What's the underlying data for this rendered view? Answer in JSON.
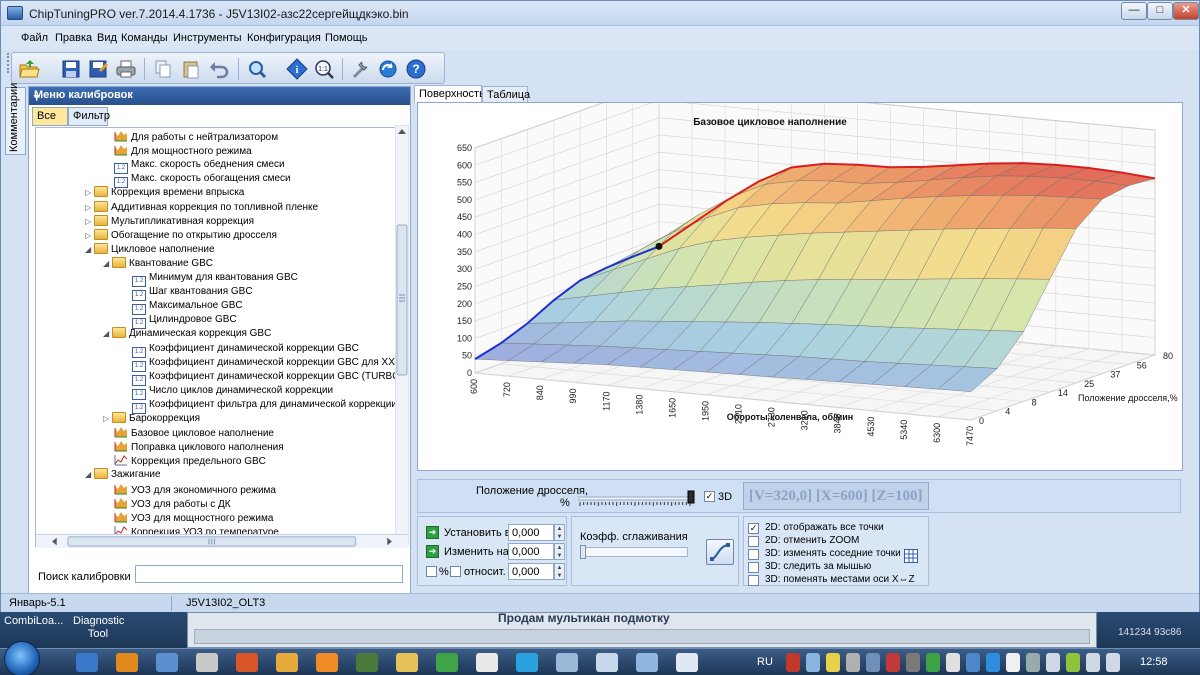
{
  "window": {
    "title": "ChipTuningPRO ver.7.2014.4.1736 - J5V13I02-азс22сергейщдкэко.bin",
    "min_label": "—",
    "max_label": "□",
    "close_label": "✕"
  },
  "menu": [
    "Файл",
    "Правка",
    "Вид",
    "Команды",
    "Инструменты",
    "Конфигурация",
    "Помощь"
  ],
  "toolbar_icons": [
    "open-folder-icon",
    "save-icon",
    "save-as-icon",
    "print-icon",
    "copy-icon",
    "paste-icon",
    "undo-icon",
    "find-icon",
    "info-icon",
    "zoom-icon",
    "tools-icon",
    "refresh-icon",
    "help-icon"
  ],
  "side_tab": "Комментарии",
  "calibration_panel": {
    "title": "Меню калибровок",
    "pin": "ᚁ",
    "tab_all": "Все",
    "tab_filter": "Фильтр",
    "search_label": "Поиск калибровки",
    "search_value": ""
  },
  "tree": [
    {
      "label": "Для работы с нейтрализатором",
      "icon": "chart",
      "level": 3
    },
    {
      "label": "Для мощностного режима",
      "icon": "chart",
      "level": 3
    },
    {
      "label": "Макс. скорость обеднения смеси",
      "icon": "table",
      "level": 3
    },
    {
      "label": "Макс. скорость обогащения смеси",
      "icon": "table",
      "level": 3
    },
    {
      "label": "Коррекция времени впрыска",
      "icon": "folder",
      "level": 2,
      "arrow": "▷"
    },
    {
      "label": "Аддитивная коррекция по топливной пленке",
      "icon": "folder",
      "level": 2,
      "arrow": "▷"
    },
    {
      "label": "Мультипликативная коррекция",
      "icon": "folder",
      "level": 2,
      "arrow": "▷"
    },
    {
      "label": "Обогащение по открытию дросселя",
      "icon": "folder",
      "level": 2,
      "arrow": "▷"
    },
    {
      "label": "Цикловое наполнение",
      "icon": "folder",
      "level": 2,
      "arrow": "◢"
    },
    {
      "label": "Квантование GBC",
      "icon": "folder",
      "level": 3,
      "arrow": "◢"
    },
    {
      "label": "Минимум для квантования GBC",
      "icon": "table",
      "level": 4
    },
    {
      "label": "Шаг квантования GBC",
      "icon": "table",
      "level": 4
    },
    {
      "label": "Максимальное GBC",
      "icon": "table",
      "level": 4
    },
    {
      "label": "Цилиндровое GBC",
      "icon": "table",
      "level": 4
    },
    {
      "label": "Динамическая коррекция GBC",
      "icon": "folder",
      "level": 3,
      "arrow": "◢"
    },
    {
      "label": "Коэффициент динамической коррекции GBC",
      "icon": "table",
      "level": 4
    },
    {
      "label": "Коэффициент динамической коррекции GBC для XX",
      "icon": "table",
      "level": 4
    },
    {
      "label": "Коэффициент динамической коррекции GBC (TURBO)",
      "icon": "table",
      "level": 4
    },
    {
      "label": "Число циклов динамической коррекции",
      "icon": "table",
      "level": 4
    },
    {
      "label": "Коэффициент фильтра для динамической коррекции",
      "icon": "table",
      "level": 4
    },
    {
      "label": "Барокоррекция",
      "icon": "folder",
      "level": 3,
      "arrow": "▷"
    },
    {
      "label": "Базовое цикловое наполнение",
      "icon": "chart",
      "level": 3
    },
    {
      "label": "Поправка циклового наполнения",
      "icon": "chart",
      "level": 3
    },
    {
      "label": "Коррекция предельного GBC",
      "icon": "line",
      "level": 3
    },
    {
      "label": "Зажигание",
      "icon": "folder",
      "level": 2,
      "arrow": "◢"
    },
    {
      "label": "УОЗ для экономичного режима",
      "icon": "chart",
      "level": 3
    },
    {
      "label": "УОЗ для работы с ДК",
      "icon": "chart",
      "level": 3
    },
    {
      "label": "УОЗ для мощностного режима",
      "icon": "chart",
      "level": 3
    },
    {
      "label": "Коррекция УОЗ по температуре",
      "icon": "line",
      "level": 3
    }
  ],
  "status": {
    "left": "Январь-5.1",
    "right": "J5V13I02_OLT3"
  },
  "view_tabs": [
    "Поверхность",
    "Таблица"
  ],
  "chart_data": {
    "type": "surface",
    "title": "Базовое цикловое наполнение",
    "xlabel": "Обороты коленвала, об/мин",
    "ylabel": "Положение дросселя,%",
    "x_ticks": [
      "600",
      "720",
      "840",
      "990",
      "1170",
      "1380",
      "1650",
      "1950",
      "2310",
      "2730",
      "3210",
      "3840",
      "4530",
      "5340",
      "6300",
      "7470"
    ],
    "y_ticks": [
      "0",
      "4",
      "8",
      "14",
      "25",
      "37",
      "56",
      "80"
    ],
    "z_ticks": [
      "0",
      "50",
      "100",
      "150",
      "200",
      "250",
      "300",
      "350",
      "400",
      "450",
      "500",
      "550",
      "600",
      "650"
    ],
    "zlim": [
      0,
      650
    ],
    "axis_ticks_visible": [
      "0",
      "50",
      "100",
      "150",
      "200",
      "250",
      "300",
      "350",
      "400",
      "450",
      "500",
      "550",
      "600",
      "650"
    ],
    "surface_z": [
      [
        40,
        45,
        50,
        55,
        60,
        62,
        64,
        66,
        68,
        70,
        72,
        74,
        76,
        78,
        80,
        82
      ],
      [
        60,
        66,
        72,
        78,
        82,
        86,
        90,
        94,
        98,
        102,
        104,
        106,
        110,
        114,
        118,
        122
      ],
      [
        90,
        100,
        112,
        124,
        132,
        140,
        148,
        156,
        162,
        168,
        174,
        178,
        184,
        190,
        196,
        202
      ],
      [
        130,
        150,
        170,
        190,
        205,
        220,
        236,
        250,
        262,
        272,
        280,
        290,
        300,
        310,
        318,
        326
      ],
      [
        160,
        200,
        240,
        280,
        310,
        330,
        345,
        360,
        372,
        384,
        396,
        408,
        418,
        428,
        438,
        446
      ],
      [
        170,
        230,
        290,
        340,
        380,
        400,
        412,
        420,
        436,
        452,
        466,
        478,
        488,
        496,
        500,
        504
      ],
      [
        175,
        245,
        315,
        375,
        420,
        440,
        448,
        450,
        462,
        478,
        494,
        508,
        516,
        520,
        520,
        516
      ],
      [
        178,
        252,
        326,
        392,
        442,
        462,
        468,
        470,
        480,
        494,
        508,
        518,
        522,
        522,
        518,
        510
      ]
    ],
    "front_edge_color": "#1f2fd0",
    "back_edge_color": "#d81e1e",
    "marker": {
      "x": "600",
      "y": "80",
      "z": 320
    }
  },
  "throttle": {
    "label": "Положение дросселя,",
    "unit": "%",
    "value_fraction": 1.0,
    "cb_3d_label": "3D",
    "cb_3d_checked": "✓",
    "coords": "[V=320,0] [X=600] [Z=100]"
  },
  "set_group": {
    "set_label": "Установить в",
    "set_value": "0,000",
    "change_label": "Изменить на",
    "change_value": "0,000",
    "pct_label": "%",
    "rel_label": "относит.",
    "rel_value": "0,000",
    "spin_up": "▲",
    "spin_down": "▼",
    "arrow": "➔"
  },
  "smooth": {
    "label": "Коэфф. сглаживания",
    "value_fraction": 0
  },
  "options": [
    {
      "label": "2D: отображать все точки",
      "checked": "✓"
    },
    {
      "label": "2D: отменить ZOOM",
      "checked": ""
    },
    {
      "label": "3D: изменять соседние точки",
      "checked": ""
    },
    {
      "label": "3D: следить за мышью",
      "checked": ""
    },
    {
      "label": "3D: поменять местами оси X⇔Z",
      "checked": ""
    }
  ],
  "background": {
    "combi_label": "CombiLoa...",
    "diag_label": "Diagnostic Tool",
    "bg_window_text": "Продам мультикан подмотку",
    "bg_right_text": "141234 93c86"
  },
  "taskbar": {
    "lang": "RU",
    "clock": "12:58"
  }
}
